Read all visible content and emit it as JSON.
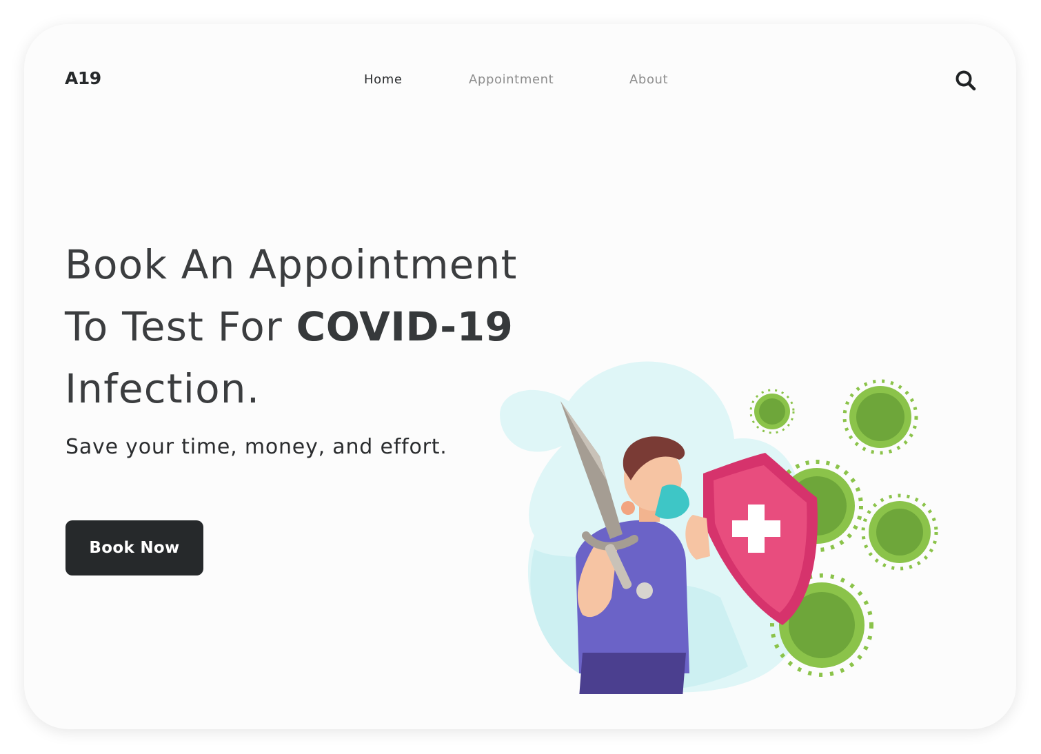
{
  "header": {
    "logo": "A19",
    "nav": [
      {
        "label": "Home",
        "active": true
      },
      {
        "label": "Appointment",
        "active": false
      },
      {
        "label": "About",
        "active": false
      }
    ],
    "search_icon": "search-icon"
  },
  "hero": {
    "line1": "Book An Appointment",
    "line2_prefix": "To Test For",
    "line2_bold": "COVID-19",
    "line3": "Infection.",
    "subtitle": "Save your time, money, and effort.",
    "cta_label": "Book Now"
  },
  "colors": {
    "primary_dark": "#26292b",
    "nav_inactive": "#8d8d8d",
    "blob": "#dff6f7",
    "shield": "#d6336c",
    "virus": "#8bc34a",
    "shirt": "#6b63c7"
  },
  "illustration": {
    "icons": [
      "sword-icon",
      "shield-icon",
      "virus-icon",
      "person-with-mask-icon"
    ]
  }
}
